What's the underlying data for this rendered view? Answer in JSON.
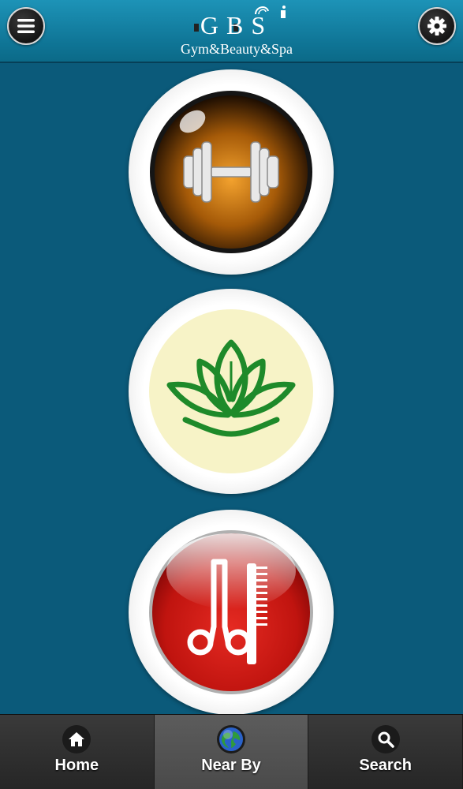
{
  "header": {
    "logo_letters": "GBS",
    "logo_subtitle": "Gym&Beauty&Spa",
    "menu_icon": "hamburger-menu-icon",
    "settings_icon": "gear-icon"
  },
  "categories": [
    {
      "icon": "dumbbell-icon"
    },
    {
      "icon": "lotus-icon"
    },
    {
      "icon": "comb-scissors-icon"
    }
  ],
  "bottom_nav": {
    "items": [
      {
        "label": "Home",
        "icon": "home-icon",
        "active": false
      },
      {
        "label": "Near By",
        "icon": "globe-icon",
        "active": true
      },
      {
        "label": "Search",
        "icon": "search-icon",
        "active": false
      }
    ]
  },
  "colors": {
    "background": "#0b5a7a",
    "header": "#0f7596",
    "gym_orange": "#e08a1e",
    "spa_green": "#1e8a2a",
    "beauty_red": "#d3191c"
  }
}
